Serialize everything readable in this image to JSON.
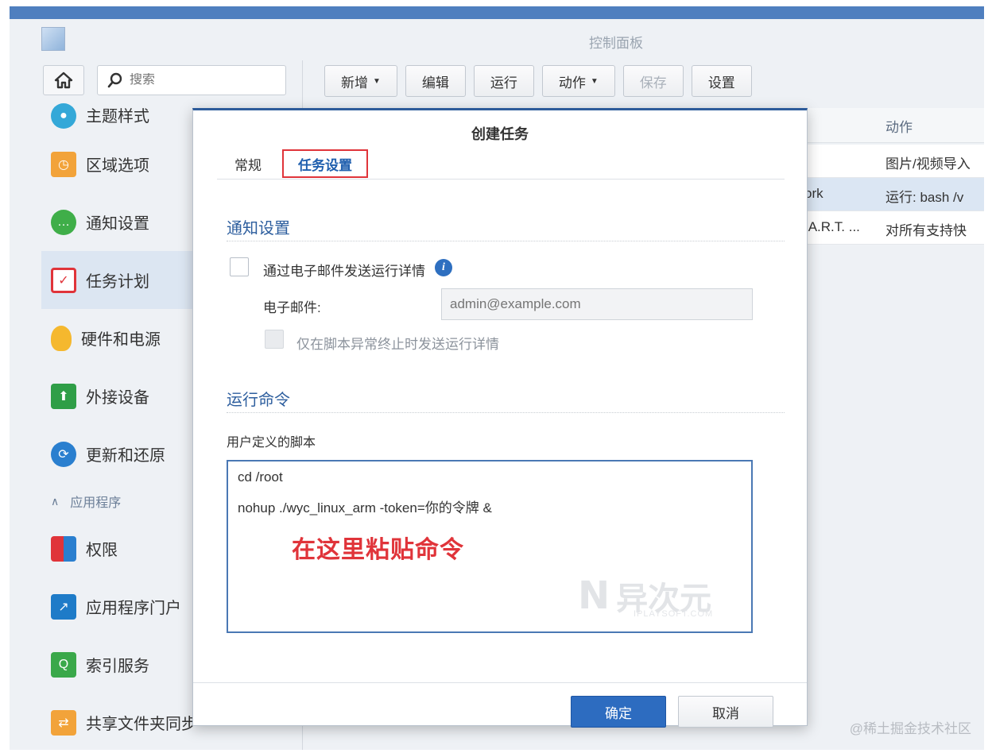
{
  "window": {
    "title": "控制面板"
  },
  "search": {
    "placeholder": "搜索"
  },
  "toolbar": {
    "create": "新增",
    "edit": "编辑",
    "run": "运行",
    "action": "动作",
    "save": "保存",
    "settings": "设置"
  },
  "sidebar": {
    "items": [
      {
        "label": "主题样式",
        "icon": "palette-icon",
        "color": "#34a8d8"
      },
      {
        "label": "区域选项",
        "icon": "region-clock-icon",
        "color": "#f2a33a"
      },
      {
        "label": "通知设置",
        "icon": "chat-bubble-icon",
        "color": "#3fae49"
      },
      {
        "label": "任务计划",
        "icon": "calendar-check-icon",
        "color": "#e0343a",
        "active": true
      },
      {
        "label": "硬件和电源",
        "icon": "lightbulb-icon",
        "color": "#f5b82e"
      },
      {
        "label": "外接设备",
        "icon": "external-device-icon",
        "color": "#2f9e47"
      },
      {
        "label": "更新和还原",
        "icon": "refresh-icon",
        "color": "#2a7fcf"
      }
    ],
    "section_label": "应用程序",
    "app_items": [
      {
        "label": "权限",
        "icon": "permission-grid-icon",
        "color": "#e0343a"
      },
      {
        "label": "应用程序门户",
        "icon": "portal-arrow-icon",
        "color": "#1e7bc8"
      },
      {
        "label": "索引服务",
        "icon": "magnifier-icon",
        "color": "#3aa84a"
      },
      {
        "label": "共享文件夹同步",
        "icon": "folder-sync-icon",
        "color": "#f2a33a"
      }
    ]
  },
  "table": {
    "header_action": "动作",
    "rows": [
      {
        "name": "",
        "action": "图片/视频导入"
      },
      {
        "name": "ork",
        "action": "运行: bash /v"
      },
      {
        "name": ".A.R.T. ...",
        "action": "对所有支持快"
      }
    ]
  },
  "dialog": {
    "title": "创建任务",
    "tabs": {
      "general": "常规",
      "task_settings": "任务设置"
    },
    "notify_section": "通知设置",
    "email_checkbox_label": "通过电子邮件发送运行详情",
    "email_label": "电子邮件:",
    "email_placeholder": "admin@example.com",
    "abnormal_label": "仅在脚本异常终止时发送运行详情",
    "run_section": "运行命令",
    "script_label": "用户定义的脚本",
    "script_lines": [
      "cd /root",
      "nohup ./wyc_linux_arm -token=你的令牌 &"
    ],
    "hint": "在这里粘贴命令",
    "watermark_text": "异次元",
    "watermark_sub": "IPLAYSOFT.COM",
    "ok": "确定",
    "cancel": "取消"
  },
  "credit": "@稀土掘金技术社区"
}
